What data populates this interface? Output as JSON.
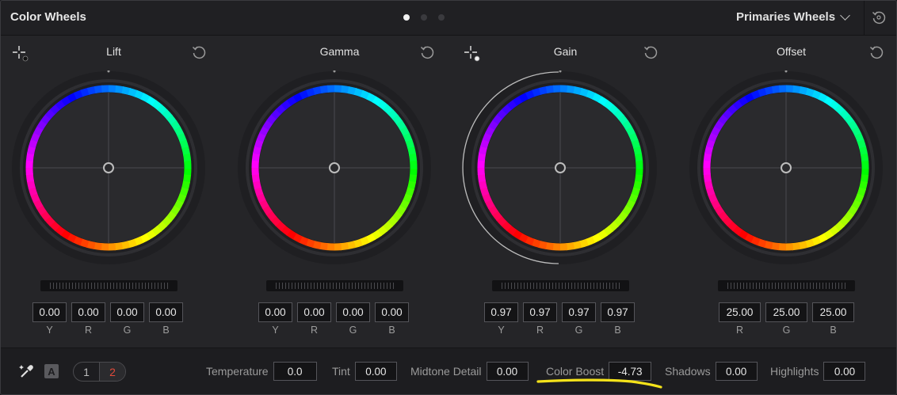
{
  "header": {
    "title": "Color Wheels",
    "mode": "Primaries Wheels",
    "page_dots": 3,
    "active_dot": 0
  },
  "wheels": [
    {
      "label": "Lift",
      "values": [
        "0.00",
        "0.00",
        "0.00",
        "0.00"
      ],
      "channels": [
        "Y",
        "R",
        "G",
        "B"
      ],
      "picker": true
    },
    {
      "label": "Gamma",
      "values": [
        "0.00",
        "0.00",
        "0.00",
        "0.00"
      ],
      "channels": [
        "Y",
        "R",
        "G",
        "B"
      ],
      "picker": false
    },
    {
      "label": "Gain",
      "values": [
        "0.97",
        "0.97",
        "0.97",
        "0.97"
      ],
      "channels": [
        "Y",
        "R",
        "G",
        "B"
      ],
      "picker": true
    },
    {
      "label": "Offset",
      "values": [
        "25.00",
        "25.00",
        "25.00"
      ],
      "channels": [
        "R",
        "G",
        "B"
      ],
      "picker": false
    }
  ],
  "footer": {
    "auto_label": "A",
    "page_1": "1",
    "page_2": "2",
    "params": [
      {
        "label": "Temperature",
        "value": "0.0"
      },
      {
        "label": "Tint",
        "value": "0.00"
      },
      {
        "label": "Midtone Detail",
        "value": "0.00"
      },
      {
        "label": "Color Boost",
        "value": "-4.73"
      },
      {
        "label": "Shadows",
        "value": "0.00"
      },
      {
        "label": "Highlights",
        "value": "0.00"
      }
    ]
  },
  "colors": {
    "highlight_underline": "#f5e31a",
    "accent_red": "#e24a3a"
  },
  "icons": {
    "picker": "crosshair-picker-icon",
    "reset": "reset-icon",
    "eyedropper": "eyedropper-icon"
  }
}
